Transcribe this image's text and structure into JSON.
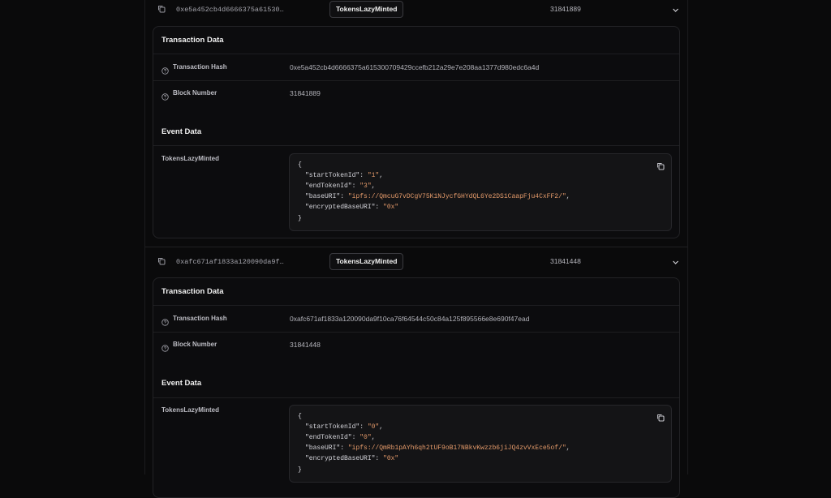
{
  "events": [
    {
      "hash_short": "0xe5a452cb4d6666375a61530…",
      "badge": "TokensLazyMinted",
      "block": "31841889",
      "section_tx": "Transaction Data",
      "label_hash": "Transaction Hash",
      "hash_full": "0xe5a452cb4d6666375a615300709429ccefb212a29e7e208aa1377d980edc6a4d",
      "label_block": "Block Number",
      "block_value": "31841889",
      "section_event": "Event Data",
      "event_name": "TokensLazyMinted",
      "json": {
        "open": "{",
        "close": "}",
        "fields": [
          {
            "key": "\"startTokenId\"",
            "sep": ": ",
            "value": "\"1\"",
            "comma": ","
          },
          {
            "key": "\"endTokenId\"",
            "sep": ": ",
            "value": "\"3\"",
            "comma": ","
          },
          {
            "key": "\"baseURI\"",
            "sep": ": ",
            "value": "\"ipfs://QmcuG7vDCgV75K1NJycfGHYdQL6Ye2DS1CaapFju4CxFF2/\"",
            "comma": ","
          },
          {
            "key": "\"encryptedBaseURI\"",
            "sep": ": ",
            "value": "\"0x\"",
            "comma": ""
          }
        ]
      }
    },
    {
      "hash_short": "0xafc671af1833a120090da9f…",
      "badge": "TokensLazyMinted",
      "block": "31841448",
      "section_tx": "Transaction Data",
      "label_hash": "Transaction Hash",
      "hash_full": "0xafc671af1833a120090da9f10ca76f64544c50c84a125f895566e8e690f47ead",
      "label_block": "Block Number",
      "block_value": "31841448",
      "section_event": "Event Data",
      "event_name": "TokensLazyMinted",
      "json": {
        "open": "{",
        "close": "}",
        "fields": [
          {
            "key": "\"startTokenId\"",
            "sep": ": ",
            "value": "\"0\"",
            "comma": ","
          },
          {
            "key": "\"endTokenId\"",
            "sep": ": ",
            "value": "\"0\"",
            "comma": ","
          },
          {
            "key": "\"baseURI\"",
            "sep": ": ",
            "value": "\"ipfs://QmRb1pAYh6qh2tUF9oB17NBkvKwzzb6jiJQ4zvVxEce5of/\"",
            "comma": ","
          },
          {
            "key": "\"encryptedBaseURI\"",
            "sep": ": ",
            "value": "\"0x\"",
            "comma": ""
          }
        ]
      }
    }
  ],
  "icons": {
    "copy": "copy-icon",
    "chevron": "chevron-down-icon",
    "help": "help-circle-icon"
  },
  "colors": {
    "background": "#0a0a0b",
    "card": "#0c0c0e",
    "string_value": "#e49a6a"
  }
}
